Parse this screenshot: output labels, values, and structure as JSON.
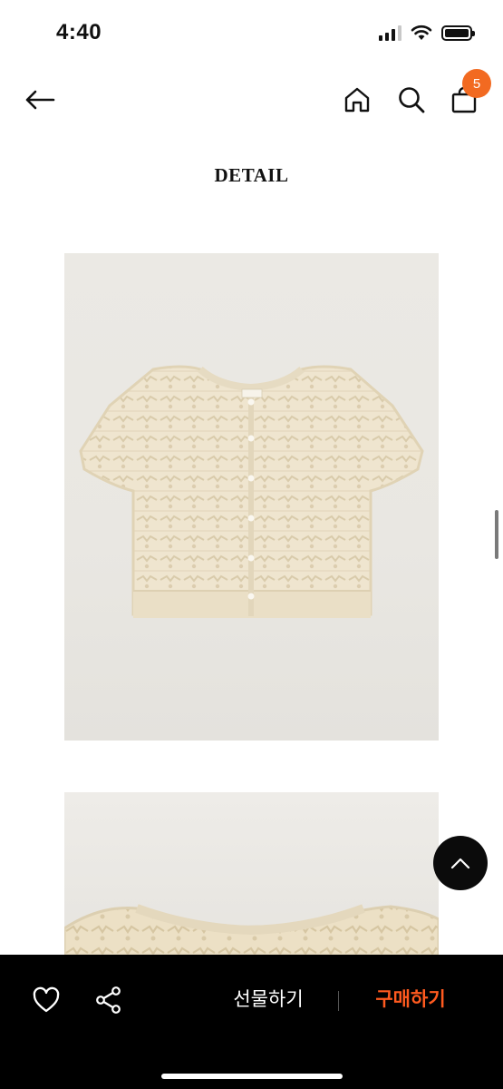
{
  "status_bar": {
    "time": "4:40"
  },
  "header": {
    "cart_count": "5"
  },
  "page": {
    "section_title": "DETAIL"
  },
  "product_images": [
    {
      "name": "cream-knit-cardigan-front",
      "label": "aocdew"
    },
    {
      "name": "cream-knit-cardigan-closeup"
    }
  ],
  "bottom_bar": {
    "gift_label": "선물하기",
    "buy_label": "구매하기"
  },
  "colors": {
    "accent": "#f26a21",
    "buy": "#ff5a1f",
    "bar_bg": "#000000"
  },
  "icons": [
    "back-arrow-icon",
    "home-icon",
    "search-icon",
    "cart-icon",
    "chevron-up-icon",
    "heart-icon",
    "share-icon"
  ]
}
